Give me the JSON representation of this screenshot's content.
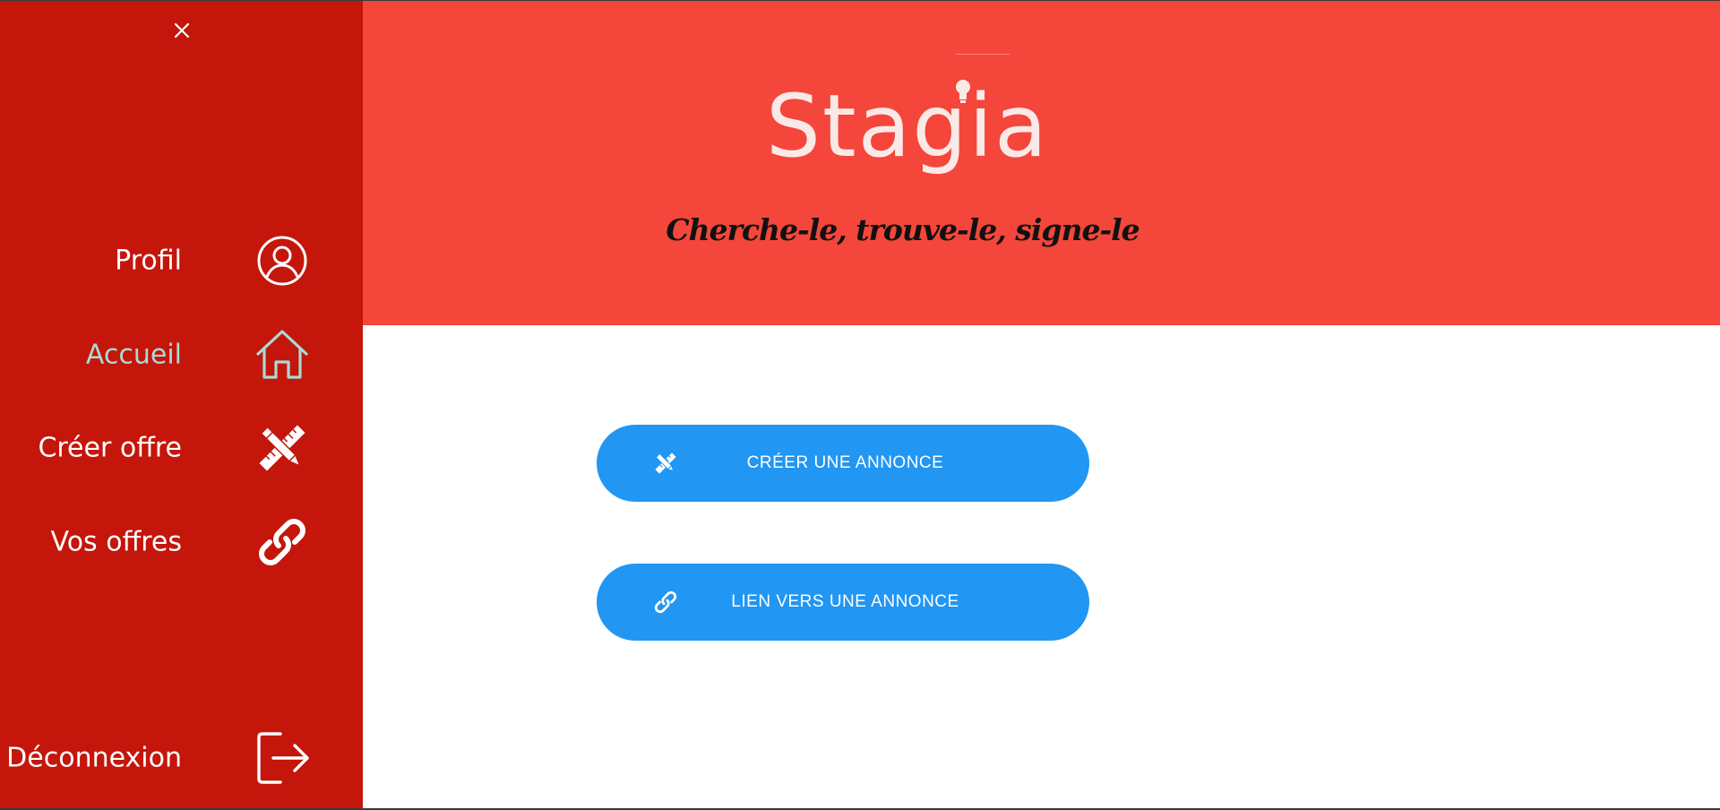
{
  "colors": {
    "sidebar_bg": "#c4160b",
    "header_bg": "#f4463a",
    "button_bg": "#2196f3",
    "active_nav": "#a5dcd6",
    "text_light": "#ffffff"
  },
  "sidebar": {
    "close_icon": "close-icon",
    "items": [
      {
        "label": "Profil",
        "icon": "user-circle-icon",
        "active": false
      },
      {
        "label": "Accueil",
        "icon": "home-icon",
        "active": true
      },
      {
        "label": "Créer offre",
        "icon": "pencil-ruler-icon",
        "active": false
      },
      {
        "label": "Vos offres",
        "icon": "link-icon",
        "active": false
      }
    ],
    "logout": {
      "label": "Déconnexion",
      "icon": "logout-icon"
    }
  },
  "header": {
    "logo_text": "Stagia",
    "tagline": "Cherche-le, trouve-le, signe-le"
  },
  "main": {
    "buttons": [
      {
        "label": "CRÉER UNE ANNONCE",
        "icon": "pencil-ruler-icon"
      },
      {
        "label": "LIEN VERS UNE ANNONCE",
        "icon": "link-icon"
      }
    ]
  }
}
